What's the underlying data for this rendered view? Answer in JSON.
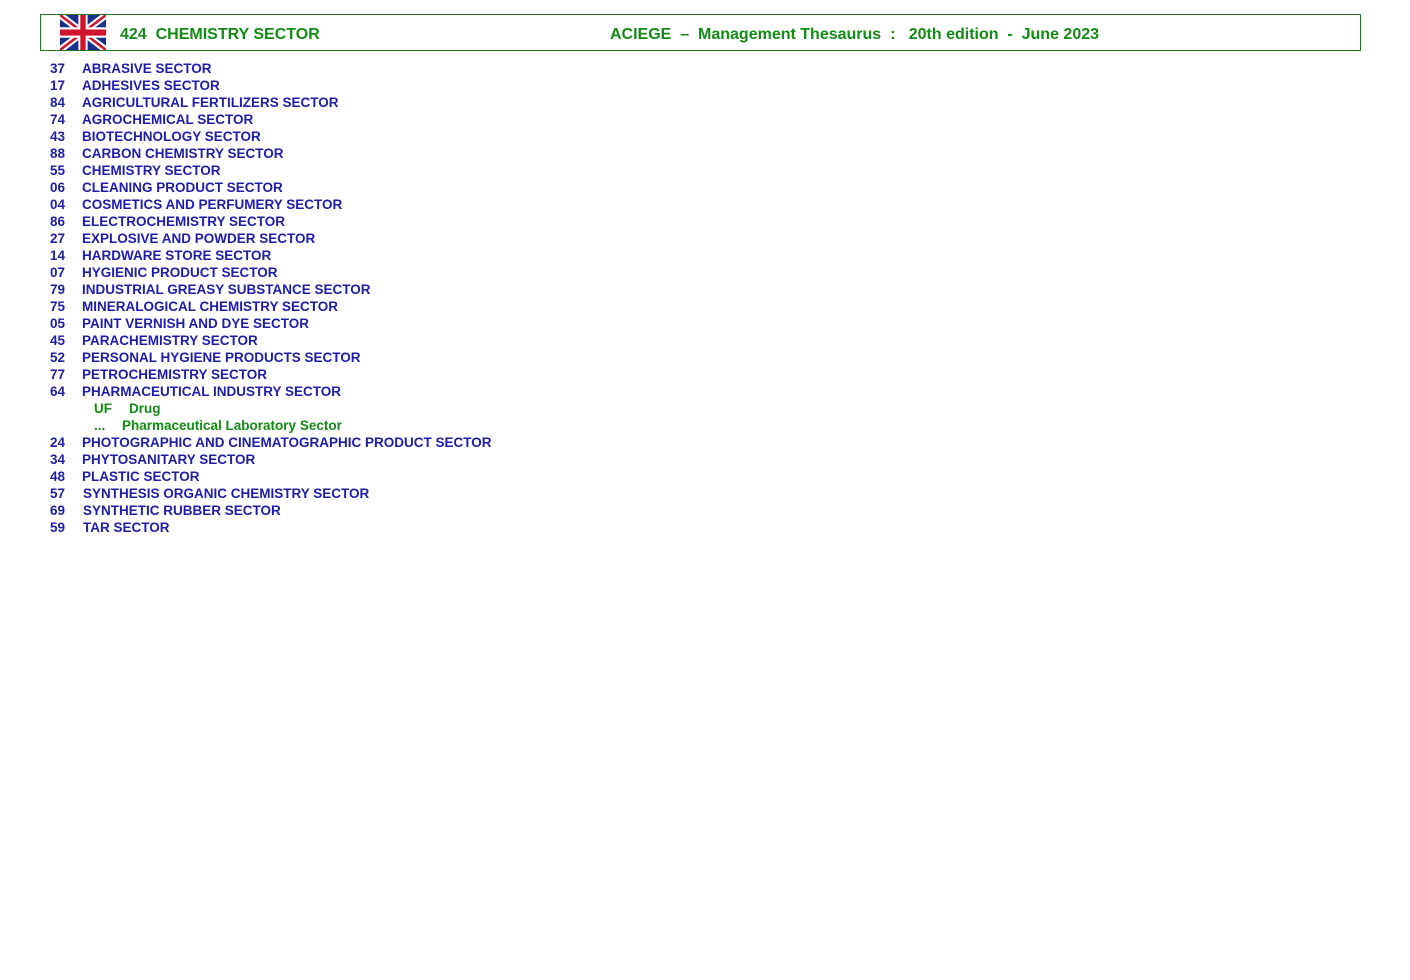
{
  "header": {
    "flag_icon": "uk-flag-icon",
    "sector_code": "424",
    "sector_name": "CHEMISTRY SECTOR",
    "thesaurus": "ACIEGE  –  Management Thesaurus  :   20th edition  -  June 2023"
  },
  "colors": {
    "term": "#1d1da8",
    "note": "#138a13",
    "border": "#1f7a1f"
  },
  "entries": [
    {
      "code": "37",
      "label": "ABRASIVE SECTOR"
    },
    {
      "code": "17",
      "label": "ADHESIVES SECTOR"
    },
    {
      "code": "84",
      "label": "AGRICULTURAL FERTILIZERS SECTOR"
    },
    {
      "code": "74",
      "label": "AGROCHEMICAL SECTOR"
    },
    {
      "code": "43",
      "label": "BIOTECHNOLOGY SECTOR"
    },
    {
      "code": "88",
      "label": "CARBON CHEMISTRY SECTOR"
    },
    {
      "code": "55",
      "label": "CHEMISTRY SECTOR"
    },
    {
      "code": "06",
      "label": "CLEANING PRODUCT SECTOR"
    },
    {
      "code": "04",
      "label": "COSMETICS AND PERFUMERY SECTOR"
    },
    {
      "code": "86",
      "label": "ELECTROCHEMISTRY SECTOR"
    },
    {
      "code": "27",
      "label": "EXPLOSIVE AND POWDER SECTOR"
    },
    {
      "code": "14",
      "label": "HARDWARE STORE SECTOR"
    },
    {
      "code": "07",
      "label": "HYGIENIC PRODUCT SECTOR"
    },
    {
      "code": "79",
      "label": "INDUSTRIAL GREASY SUBSTANCE SECTOR"
    },
    {
      "code": "75",
      "label": "MINERALOGICAL CHEMISTRY SECTOR"
    },
    {
      "code": "05",
      "label": "PAINT VERNISH AND DYE SECTOR"
    },
    {
      "code": "45",
      "label": "PARACHEMISTRY SECTOR"
    },
    {
      "code": "52",
      "label": "PERSONAL HYGIENE PRODUCTS SECTOR"
    },
    {
      "code": "77",
      "label": "PETROCHEMISTRY SECTOR"
    },
    {
      "code": "64",
      "label": "PHARMACEUTICAL INDUSTRY SECTOR"
    }
  ],
  "pharma_notes": {
    "uf_prefix": "UF",
    "uf_label": "Drug",
    "nt_prefix": "...",
    "nt_label": "Pharmaceutical Laboratory Sector"
  },
  "entries_after": [
    {
      "code": "24",
      "label": "PHOTOGRAPHIC AND CINEMATOGRAPHIC PRODUCT SECTOR"
    },
    {
      "code": "34",
      "label": "PHYTOSANITARY SECTOR"
    },
    {
      "code": "48",
      "label": "PLASTIC SECTOR"
    },
    {
      "code": "57",
      "label": "SYNTHESIS ORGANIC CHEMISTRY SECTOR"
    },
    {
      "code": "69",
      "label": "SYNTHETIC RUBBER SECTOR"
    },
    {
      "code": "59",
      "label": "TAR SECTOR"
    }
  ]
}
